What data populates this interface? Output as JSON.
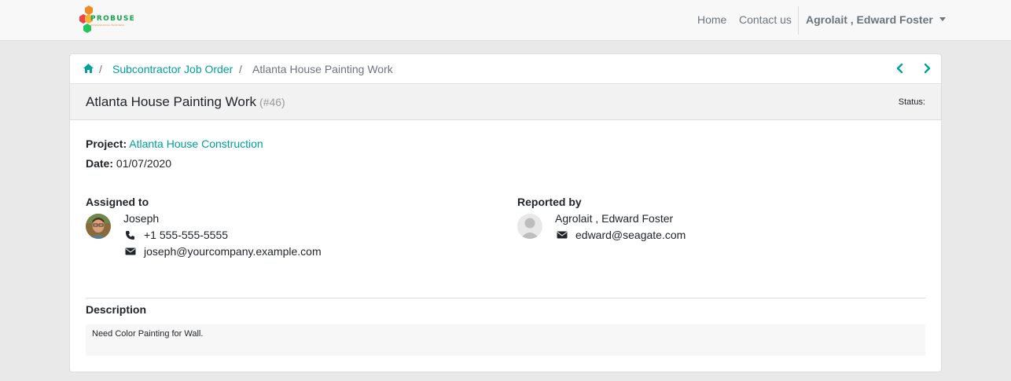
{
  "navbar": {
    "logo_text": "PROBUSE",
    "logo_subtext": "PROFESSIONAL BUSINESS",
    "links": [
      "Home",
      "Contact us"
    ],
    "user": "Agrolait , Edward Foster"
  },
  "breadcrumb": {
    "home_icon": "home-icon",
    "items": [
      "Subcontractor Job Order",
      "Atlanta House Painting Work"
    ],
    "separator": "/"
  },
  "pager": {
    "prev_icon": "chevron-left-icon",
    "next_icon": "chevron-right-icon"
  },
  "record": {
    "title": "Atlanta House Painting Work",
    "ref": "(#46)",
    "status_label": "Status:",
    "project_label": "Project:",
    "project": "Atlanta House Construction",
    "date_label": "Date:",
    "date": "01/07/2020"
  },
  "assigned": {
    "heading": "Assigned to",
    "name": "Joseph",
    "phone": "+1 555-555-5555",
    "email": "joseph@yourcompany.example.com"
  },
  "reported": {
    "heading": "Reported by",
    "name": "Agrolait , Edward Foster",
    "email": "edward@seagate.com"
  },
  "description": {
    "heading": "Description",
    "text": "Need Color Painting for Wall."
  },
  "colors": {
    "accent": "#00a09d",
    "muted": "#6c757d",
    "background": "#e9e9e9"
  }
}
